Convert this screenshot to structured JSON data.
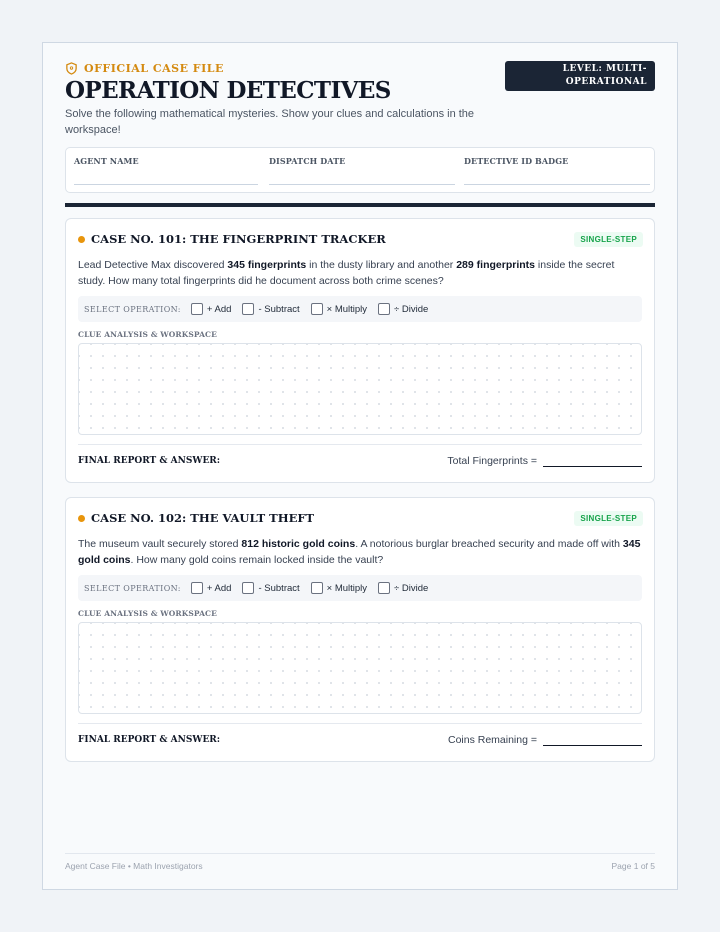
{
  "header": {
    "eyebrow": "OFFICIAL CASE FILE",
    "title": "OPERATION DETECTIVES",
    "subtitle": "Solve the following mathematical mysteries. Show your clues and calculations in the workspace!",
    "level_line1": "LEVEL: MULTI-",
    "level_line2": "OPERATIONAL"
  },
  "agent_fields": [
    "AGENT NAME",
    "DISPATCH DATE",
    "DETECTIVE ID BADGE"
  ],
  "operations_label": "SELECT OPERATION:",
  "operations": [
    "+ Add",
    "- Subtract",
    "× Multiply",
    "÷ Divide"
  ],
  "workspace_label": "CLUE ANALYSIS & WORKSPACE",
  "final_label": "FINAL REPORT & ANSWER:",
  "cases": [
    {
      "title": "CASE NO. 101: THE FINGERPRINT TRACKER",
      "tag": "SINGLE-STEP",
      "p1": "Lead Detective Max discovered ",
      "b1": "345 fingerprints",
      "p2": " in the dusty library and another ",
      "b2": "289 fingerprints",
      "p3": " inside the secret study. How many total fingerprints did he document across both crime scenes?",
      "answer_label": "Total Fingerprints ="
    },
    {
      "title": "CASE NO. 102: THE VAULT THEFT",
      "tag": "SINGLE-STEP",
      "p1": "The museum vault securely stored ",
      "b1": "812 historic gold coins",
      "p2": ". A notorious burglar breached security and made off with ",
      "b2": "345 gold coins",
      "p3": ". How many gold coins remain locked inside the vault?",
      "answer_label": "Coins Remaining ="
    }
  ],
  "footer": {
    "left": "Agent Case File • Math Investigators",
    "right": "Page 1 of 5"
  },
  "colors": {
    "accent": "#d48a10",
    "dark": "#1b2535",
    "tag_green": "#16a34a"
  }
}
